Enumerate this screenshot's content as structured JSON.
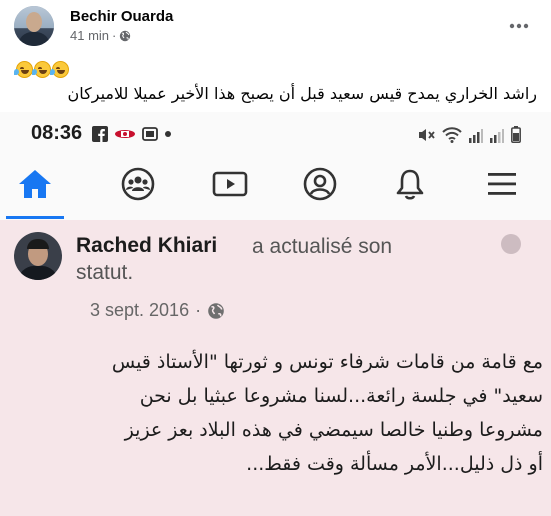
{
  "post": {
    "author": "Bechir Ouarda",
    "time": "41 min",
    "separator": "·",
    "privacy_icon": "globe-icon",
    "more_icon": "more-horizontal-icon",
    "emojis": [
      "rofl-emoji",
      "rofl-emoji",
      "rofl-emoji"
    ],
    "text": "راشد الخراري يمدح قيس سعيد قبل أن يصبح هذا الأخير عميلا للاميركان"
  },
  "screenshot": {
    "status_bar": {
      "time": "08:36",
      "left_icons": [
        "facebook-icon",
        "cast-icon",
        "gallery-icon",
        "dot-icon"
      ],
      "right_icons": [
        "mute-icon",
        "wifi-icon",
        "signal-icon",
        "signal-icon",
        "battery-icon"
      ]
    },
    "nav": {
      "items": [
        "home-icon",
        "groups-icon",
        "watch-icon",
        "profile-icon",
        "notifications-icon",
        "menu-icon"
      ],
      "active": "home-icon",
      "accent": "#1877f2"
    },
    "card": {
      "name": "Rached Khiari",
      "action_line1": "a actualisé son",
      "action_line2": "statut.",
      "date": "3 sept. 2016",
      "separator": "·",
      "lines": [
        "مع قامة من قامات شرفاء تونس و ثورتها \"الأستاذ قيس",
        "سعيد\" في جلسة رائعة...لسنا مشروعا عبثيا بل نحن",
        "مشروعا وطنيا خالصا سيمضي في هذه البلاد بعز عزيز",
        "أو ذل ذليل...الأمر مسألة وقت فقط..."
      ]
    }
  }
}
